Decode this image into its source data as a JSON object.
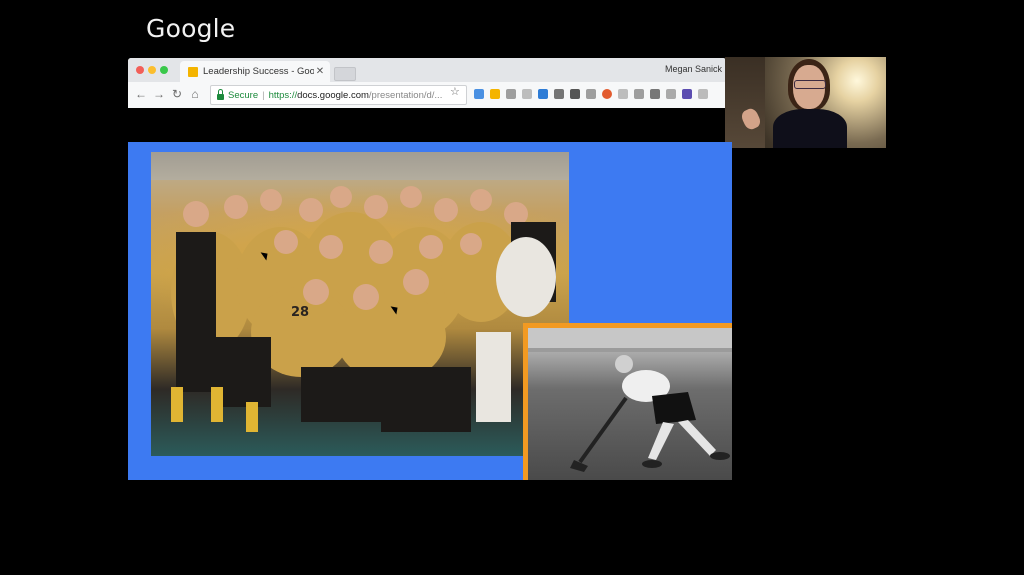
{
  "overlay": {
    "logo_text": "Google"
  },
  "browser": {
    "tab": {
      "title": "Leadership Success - Google"
    },
    "profile_name": "Megan Sanick",
    "omnibox": {
      "security_label": "Secure",
      "scheme": "https://",
      "host": "docs.google.com",
      "path": "/presentation/d/..."
    },
    "icons": [
      "back-icon",
      "forward-icon",
      "reload-icon",
      "home-icon",
      "star-icon"
    ]
  },
  "colors": {
    "slide_background": "#3d7af2",
    "inset_border": "#f29a22",
    "secure_green": "#1c8a3c",
    "page_background": "#000000"
  }
}
